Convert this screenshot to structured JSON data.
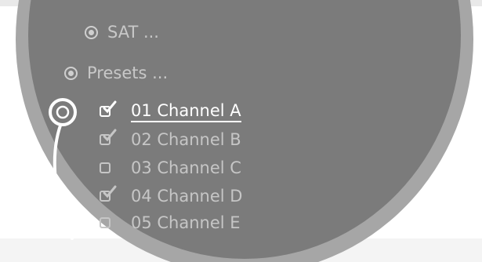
{
  "menu": {
    "sat_label": "SAT ...",
    "presets_label": "Presets ..."
  },
  "channels": [
    {
      "label": "01 Channel A",
      "checked": true,
      "selected": true
    },
    {
      "label": "02 Channel B",
      "checked": true,
      "selected": false
    },
    {
      "label": "03 Channel C",
      "checked": false,
      "selected": false
    },
    {
      "label": "04 Channel D",
      "checked": true,
      "selected": false
    },
    {
      "label": "05 Channel E",
      "checked": false,
      "selected": false
    }
  ],
  "icons": {
    "menu_item": "radio-icon",
    "channel_toggle": "checkbox-icon",
    "controller_position": "controller-ring-icon"
  },
  "colors": {
    "display": "#7b7b7b",
    "bezel": "#a6a6a6",
    "text": "#c8c8c8",
    "selected_text": "#ffffff"
  }
}
